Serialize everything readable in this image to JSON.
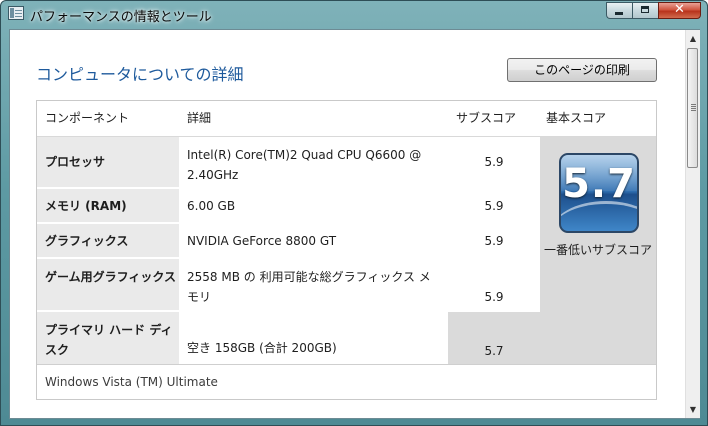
{
  "window": {
    "title": "パフォーマンスの情報とツール",
    "close_symbol": "✕"
  },
  "content": {
    "heading": "コンピュータについての詳細",
    "print_button": "このページの印刷",
    "headers": {
      "component": "コンポーネント",
      "detail": "詳細",
      "subscore": "サブスコア",
      "basescore": "基本スコア"
    },
    "rows": [
      {
        "component": "プロセッサ",
        "detail": "Intel(R) Core(TM)2 Quad CPU Q6600 @ 2.40GHz",
        "subscore": "5.9"
      },
      {
        "component": "メモリ (RAM)",
        "detail": "6.00 GB",
        "subscore": "5.9"
      },
      {
        "component": "グラフィックス",
        "detail": "NVIDIA GeForce 8800 GT",
        "subscore": "5.9"
      },
      {
        "component": "ゲーム用グラフィックス",
        "detail": "2558 MB の 利用可能な総グラフィックス メモリ",
        "subscore": "5.9"
      },
      {
        "component": "プライマリ ハード ディスク",
        "detail": "空き 158GB (合計 200GB)",
        "subscore": "5.7"
      }
    ],
    "base_score": "5.7",
    "base_score_caption": "一番低いサブスコア",
    "os_edition": "Windows Vista (TM) Ultimate"
  }
}
